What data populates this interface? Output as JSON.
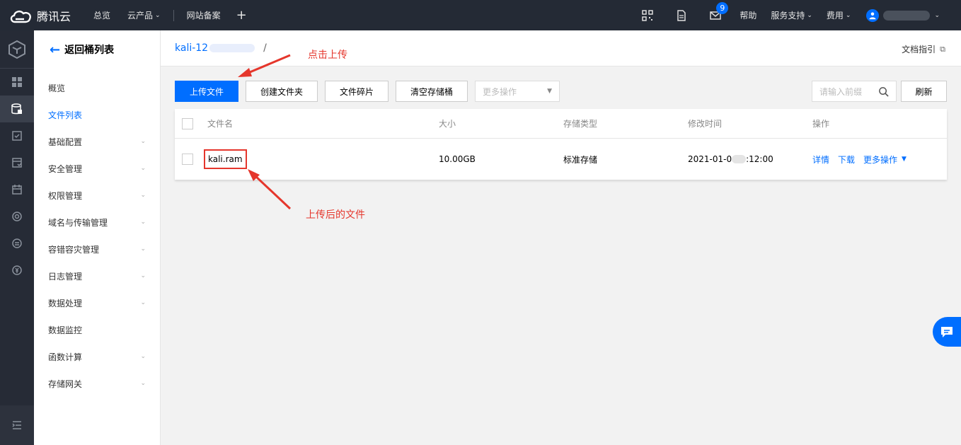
{
  "brand": {
    "name": "腾讯云"
  },
  "topnav": {
    "overview": "总览",
    "products": "云产品",
    "icp": "网站备案",
    "plus": "+"
  },
  "topright": {
    "badge_count": "9",
    "help": "帮助",
    "support": "服务支持",
    "billing": "费用"
  },
  "sidebar": {
    "back": "返回桶列表",
    "items": [
      {
        "label": "概览",
        "chevron": false
      },
      {
        "label": "文件列表",
        "chevron": false,
        "active": true
      },
      {
        "label": "基础配置",
        "chevron": true
      },
      {
        "label": "安全管理",
        "chevron": true
      },
      {
        "label": "权限管理",
        "chevron": true
      },
      {
        "label": "域名与传输管理",
        "chevron": true
      },
      {
        "label": "容错容灾管理",
        "chevron": true
      },
      {
        "label": "日志管理",
        "chevron": true
      },
      {
        "label": "数据处理",
        "chevron": true
      },
      {
        "label": "数据监控",
        "chevron": false
      },
      {
        "label": "函数计算",
        "chevron": true
      },
      {
        "label": "存储网关",
        "chevron": true
      }
    ]
  },
  "breadcrumb": {
    "bucket": "kali-12",
    "slash": "/"
  },
  "docguide": "文档指引",
  "toolbar": {
    "upload": "上传文件",
    "create_folder": "创建文件夹",
    "fragments": "文件碎片",
    "clear": "清空存储桶",
    "more": "更多操作",
    "search_placeholder": "请输入前缀",
    "refresh": "刷新"
  },
  "table": {
    "headers": {
      "name": "文件名",
      "size": "大小",
      "storage": "存储类型",
      "modified": "修改时间",
      "ops": "操作"
    },
    "rows": [
      {
        "name": "kali.ram",
        "size": "10.00GB",
        "storage": "标准存储",
        "modified_a": "2021-01-0",
        "modified_b": ":12:00",
        "op_detail": "详情",
        "op_download": "下载",
        "op_more": "更多操作"
      }
    ]
  },
  "annotations": {
    "upload_hint": "点击上传",
    "file_hint": "上传后的文件",
    "color": "#e5362c"
  },
  "colors": {
    "accent": "#006eff",
    "topbar": "#242a35",
    "rail": "#262b36"
  }
}
